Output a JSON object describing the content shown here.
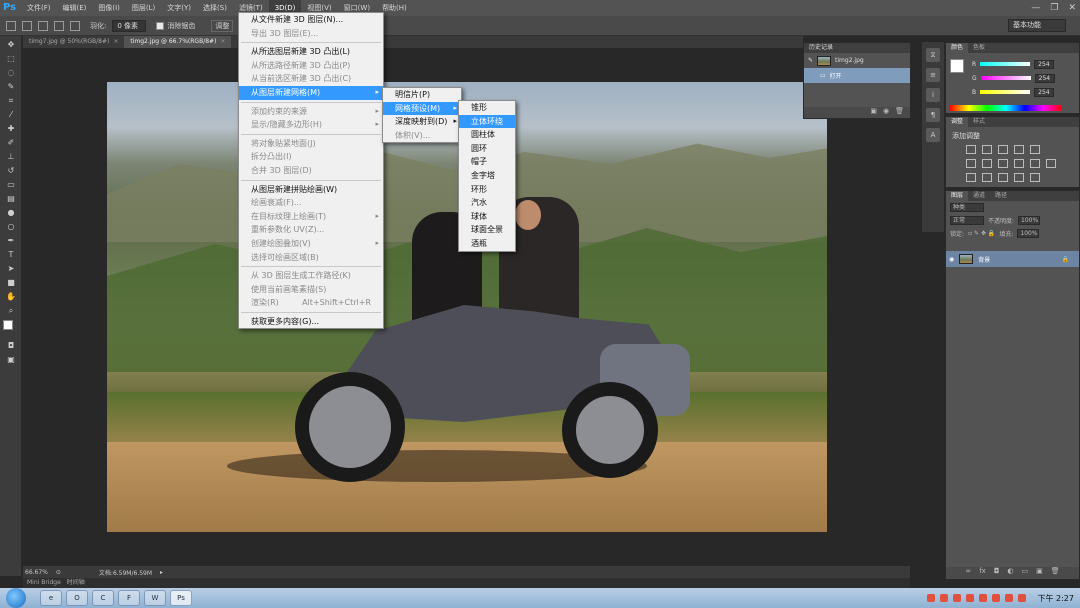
{
  "app": {
    "logo": "Ps"
  },
  "menubar": {
    "items": [
      "文件(F)",
      "编辑(E)",
      "图像(I)",
      "图层(L)",
      "文字(Y)",
      "选择(S)",
      "滤镜(T)",
      "3D(D)",
      "视图(V)",
      "窗口(W)",
      "帮助(H)"
    ],
    "active_index": 7
  },
  "optbar": {
    "feather_label": "羽化:",
    "feather_value": "0 像素",
    "antialias_label": "消除锯齿",
    "adjust_edge": "调整",
    "workspace": "基本功能"
  },
  "doctabs": [
    {
      "label": "timg7.jpg @ 50%(RGB/8#)",
      "active": false
    },
    {
      "label": "timg2.jpg @ 66.7%(RGB/8#)",
      "active": true
    }
  ],
  "menu_3d": {
    "groups": [
      [
        {
          "label": "从文件新建 3D 图层(N)...",
          "disabled": false
        },
        {
          "label": "导出 3D 图层(E)...",
          "disabled": true
        }
      ],
      [
        {
          "label": "从所选图层新建 3D 凸出(L)",
          "disabled": false
        },
        {
          "label": "从所选路径新建 3D 凸出(P)",
          "disabled": true
        },
        {
          "label": "从当前选区新建 3D 凸出(C)",
          "disabled": true
        },
        {
          "label": "从图层新建网格(M)",
          "disabled": false,
          "highlight": true,
          "submenu": true
        }
      ],
      [
        {
          "label": "添加约束的来源",
          "disabled": true,
          "submenu": true
        },
        {
          "label": "显示/隐藏多边形(H)",
          "disabled": true,
          "submenu": true
        }
      ],
      [
        {
          "label": "将对象贴紧地面(J)",
          "disabled": true
        },
        {
          "label": "拆分凸出(I)",
          "disabled": true
        },
        {
          "label": "合并 3D 图层(D)",
          "disabled": true
        }
      ],
      [
        {
          "label": "从图层新建拼贴绘画(W)",
          "disabled": false
        },
        {
          "label": "绘画衰减(F)...",
          "disabled": true
        },
        {
          "label": "在目标纹理上绘画(T)",
          "disabled": true,
          "submenu": true
        },
        {
          "label": "重新参数化 UV(Z)...",
          "disabled": true
        },
        {
          "label": "创建绘图叠加(V)",
          "disabled": true,
          "submenu": true
        },
        {
          "label": "选择可绘画区域(B)",
          "disabled": true
        }
      ],
      [
        {
          "label": "从 3D 图层生成工作路径(K)",
          "disabled": true
        },
        {
          "label": "使用当前画笔素描(S)",
          "disabled": true
        },
        {
          "label": "渲染(R)",
          "shortcut": "Alt+Shift+Ctrl+R",
          "disabled": true
        }
      ],
      [
        {
          "label": "获取更多内容(G)...",
          "disabled": false
        }
      ]
    ]
  },
  "menu_mesh": {
    "items": [
      {
        "label": "明信片(P)",
        "disabled": false
      },
      {
        "label": "网格预设(M)",
        "disabled": false,
        "highlight": true,
        "submenu": true
      },
      {
        "label": "深度映射到(D)",
        "disabled": false,
        "submenu": true
      },
      {
        "label": "体积(V)...",
        "disabled": true
      }
    ]
  },
  "menu_preset": {
    "items": [
      "锥形",
      "立体环绕",
      "圆柱体",
      "圆环",
      "帽子",
      "金字塔",
      "环形",
      "汽水",
      "球体",
      "球面全景",
      "酒瓶"
    ],
    "highlight_index": 1
  },
  "history": {
    "tab": "历史记录",
    "doc": "timg2.jpg",
    "step": "打开"
  },
  "color_panel": {
    "tabs": [
      "颜色",
      "色板"
    ],
    "channels": [
      {
        "label": "R",
        "value": "254",
        "color": "#ff3b3b"
      },
      {
        "label": "G",
        "value": "254",
        "color": "#3bff3b"
      },
      {
        "label": "B",
        "value": "254",
        "color": "#3b3bff"
      }
    ]
  },
  "adj_panel": {
    "tabs": [
      "调整",
      "样式"
    ],
    "title": "添加调整"
  },
  "layers_panel": {
    "tabs": [
      "图层",
      "通道",
      "路径"
    ],
    "kind": "种类",
    "mode": "正常",
    "opacity_label": "不透明度:",
    "opacity_value": "100%",
    "lock_label": "锁定:",
    "fill_label": "填充:",
    "fill_value": "100%",
    "layer_name": "背景"
  },
  "statusbar": {
    "zoom": "66.67%",
    "doc": "文档:6.59M/6.59M"
  },
  "minibridge": {
    "tabs": [
      "Mini Bridge",
      "时间轴"
    ]
  },
  "taskbar": {
    "clock": "下午 2:27",
    "apps": [
      "e",
      "O",
      "C",
      "F",
      "W",
      "Ps"
    ]
  }
}
